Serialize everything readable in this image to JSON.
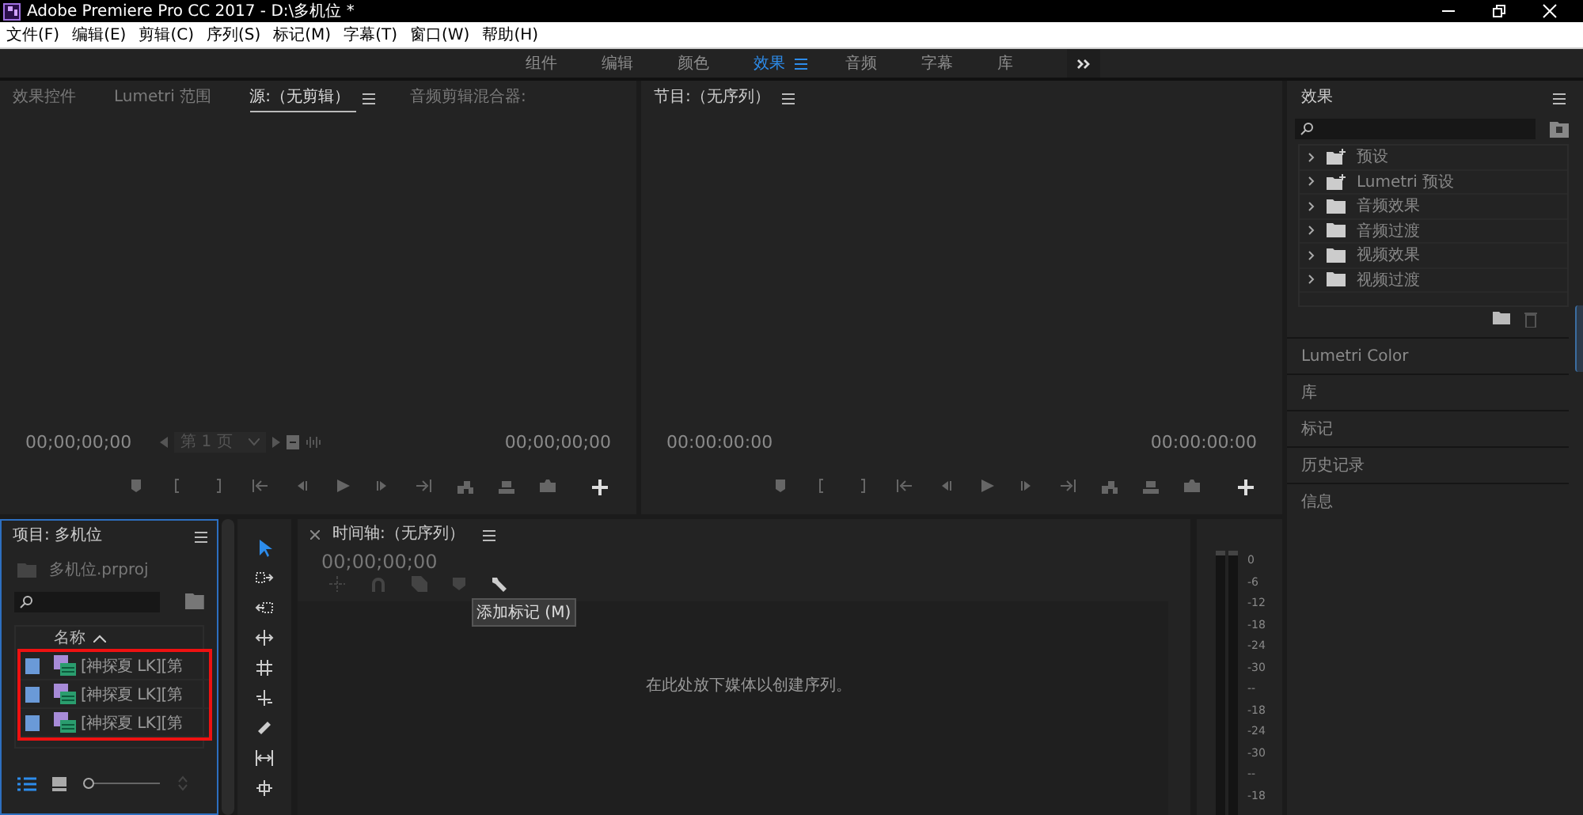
{
  "window": {
    "title": "Adobe Premiere Pro CC 2017 - D:\\多机位 *"
  },
  "menu": [
    "文件(F)",
    "编辑(E)",
    "剪辑(C)",
    "序列(S)",
    "标记(M)",
    "字幕(T)",
    "窗口(W)",
    "帮助(H)"
  ],
  "workspaces": [
    {
      "label": "组件",
      "selected": false
    },
    {
      "label": "编辑",
      "selected": false
    },
    {
      "label": "颜色",
      "selected": false
    },
    {
      "label": "效果",
      "selected": true
    },
    {
      "label": "音频",
      "selected": false
    },
    {
      "label": "字幕",
      "selected": false
    },
    {
      "label": "库",
      "selected": false
    }
  ],
  "source_panel": {
    "tabs": [
      {
        "label": "效果控件",
        "selected": false
      },
      {
        "label": "Lumetri 范围",
        "selected": false
      },
      {
        "label": "源:（无剪辑）",
        "selected": true
      },
      {
        "label": "音频剪辑混合器:",
        "selected": false
      }
    ],
    "timecode_left": "00;00;00;00",
    "page": "第 1 页",
    "timecode_right": "00;00;00;00"
  },
  "program_panel": {
    "title": "节目:（无序列）",
    "timecode_left": "00:00:00:00",
    "timecode_right": "00:00:00:00"
  },
  "effects_panel": {
    "title": "效果",
    "items": [
      {
        "label": "预设",
        "kind": "preset"
      },
      {
        "label": "Lumetri 预设",
        "kind": "preset"
      },
      {
        "label": "音频效果",
        "kind": "folder"
      },
      {
        "label": "音频过渡",
        "kind": "folder"
      },
      {
        "label": "视频效果",
        "kind": "folder"
      },
      {
        "label": "视频过渡",
        "kind": "folder"
      }
    ],
    "sections": [
      "Lumetri Color",
      "库",
      "标记",
      "历史记录",
      "信息"
    ]
  },
  "project_panel": {
    "title": "项目: 多机位",
    "file": "多机位.prproj",
    "column": "名称",
    "items": [
      {
        "name": "[神探夏 LK][第"
      },
      {
        "name": "[神探夏 LK][第"
      },
      {
        "name": "[神探夏 LK][第"
      }
    ]
  },
  "zoom": {
    "level": 0
  },
  "tools": [
    {
      "kind": "select",
      "selected": true
    },
    {
      "kind": "track",
      "selected": false
    },
    {
      "kind": "ripple",
      "selected": false
    },
    {
      "kind": "rolling",
      "selected": false
    },
    {
      "kind": "rate",
      "selected": false
    },
    {
      "kind": "slip",
      "selected": false
    },
    {
      "kind": "razor",
      "selected": false
    },
    {
      "kind": "slipclip",
      "selected": false
    },
    {
      "kind": "slide",
      "selected": false
    }
  ],
  "timeline": {
    "title": "时间轴:（无序列）",
    "timecode": "00;00;00;00",
    "tooltip": "添加标记 (M)",
    "drop_hint": "在此处放下媒体以创建序列。"
  },
  "meter": {
    "scale": [
      "0",
      "-6",
      "-12",
      "-18",
      "-24",
      "-30",
      "--",
      "-18",
      "-24",
      "-30",
      "--",
      "-18"
    ]
  }
}
